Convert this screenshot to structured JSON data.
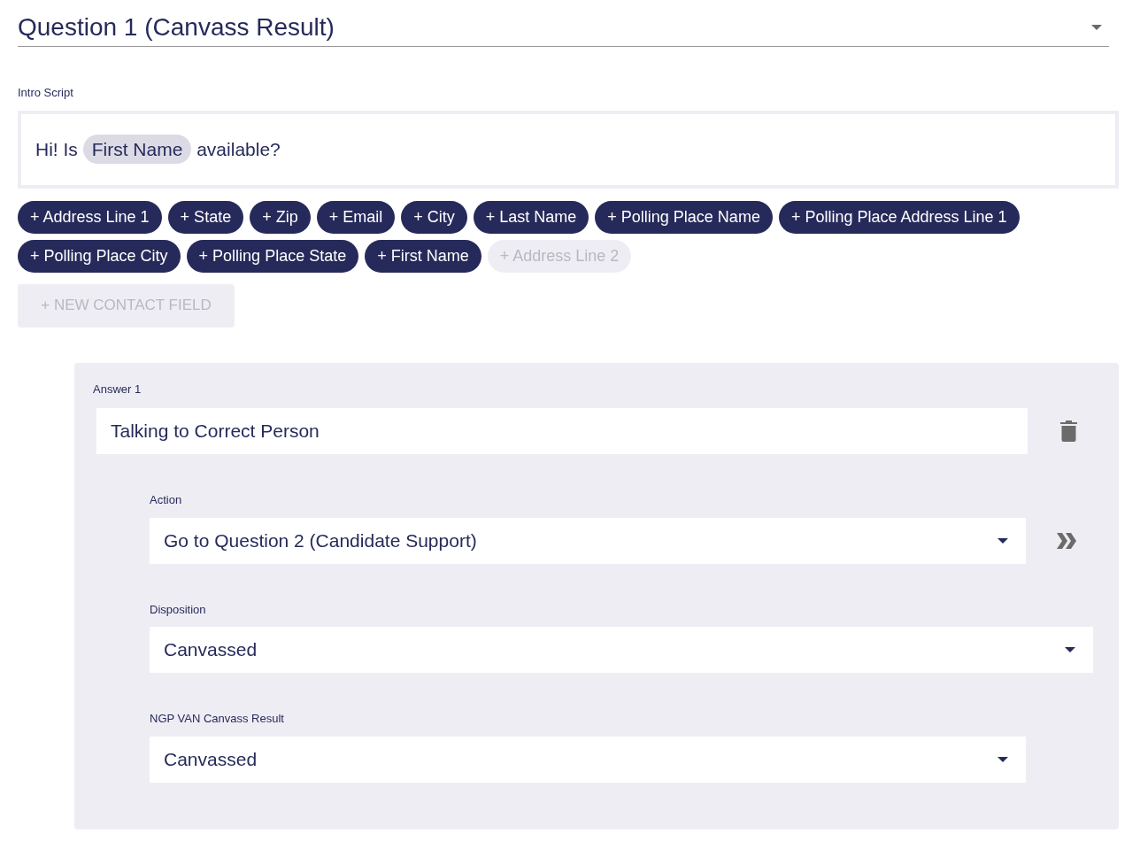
{
  "question_select": {
    "value": "Question 1 (Canvass Result)"
  },
  "intro_script": {
    "label": "Intro Script",
    "parts": [
      {
        "kind": "text",
        "text": "Hi! Is "
      },
      {
        "kind": "token",
        "text": "First Name"
      },
      {
        "kind": "text",
        "text": " available?"
      }
    ]
  },
  "field_chips": [
    {
      "label": "+ Address Line 1",
      "disabled": false
    },
    {
      "label": "+ State",
      "disabled": false
    },
    {
      "label": "+ Zip",
      "disabled": false
    },
    {
      "label": "+ Email",
      "disabled": false
    },
    {
      "label": "+ City",
      "disabled": false
    },
    {
      "label": "+ Last Name",
      "disabled": false
    },
    {
      "label": "+ Polling Place Name",
      "disabled": false
    },
    {
      "label": "+ Polling Place Address Line 1",
      "disabled": false
    },
    {
      "label": "+ Polling Place City",
      "disabled": false
    },
    {
      "label": "+ Polling Place State",
      "disabled": false
    },
    {
      "label": "+ First Name",
      "disabled": false
    },
    {
      "label": "+ Address Line 2",
      "disabled": true
    }
  ],
  "new_contact_field_button": {
    "label": "+ NEW CONTACT FIELD",
    "disabled": true
  },
  "answer": {
    "label": "Answer 1",
    "value": "Talking to Correct Person",
    "selects": [
      {
        "label": "Action",
        "value": "Go to Question 2 (Candidate Support)",
        "kind": "goto"
      },
      {
        "label": "Disposition",
        "value": "Canvassed",
        "kind": "plain"
      },
      {
        "label": "NGP VAN Canvass Result",
        "value": "Canvassed",
        "kind": "narrow"
      }
    ]
  }
}
